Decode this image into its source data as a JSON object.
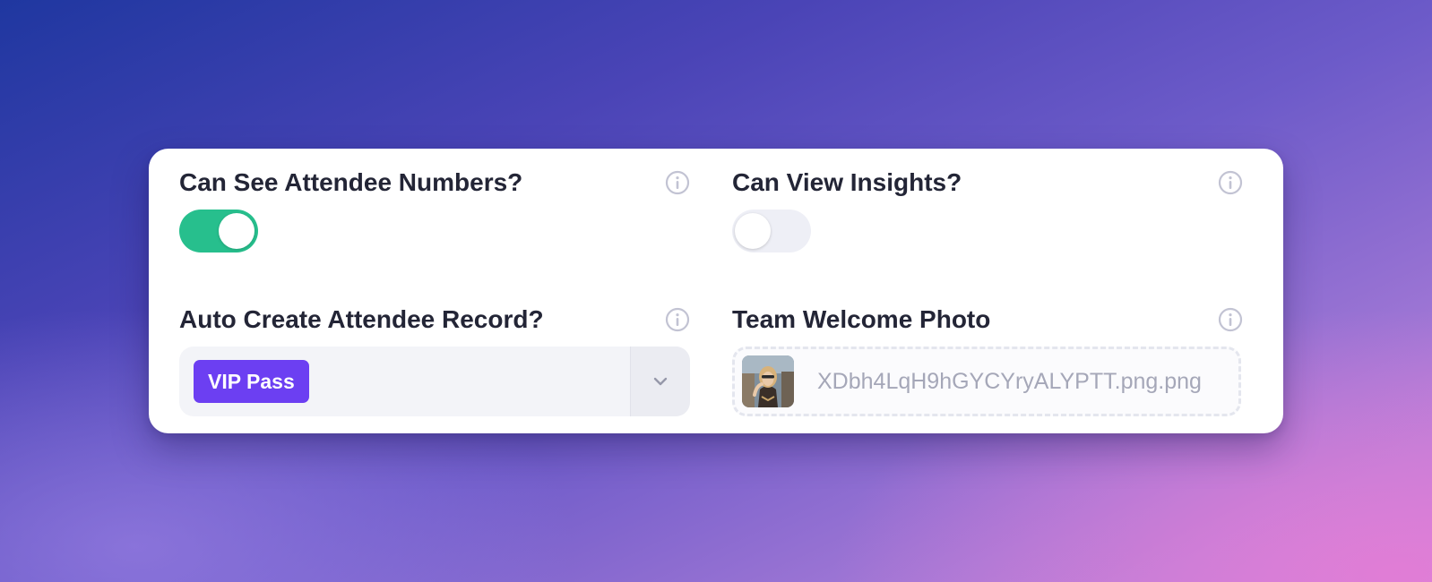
{
  "fields": {
    "attendee_numbers": {
      "label": "Can See Attendee Numbers?",
      "enabled": true,
      "info_icon": "info-circle-icon"
    },
    "view_insights": {
      "label": "Can View Insights?",
      "enabled": false,
      "info_icon": "info-circle-icon"
    },
    "auto_create_record": {
      "label": "Auto Create Attendee Record?",
      "selected_tag": "VIP Pass",
      "dropdown_icon": "chevron-down-icon",
      "info_icon": "info-circle-icon"
    },
    "team_welcome_photo": {
      "label": "Team Welcome Photo",
      "file_name": "XDbh4LqH9hGYCYryALYPTT.png.png",
      "info_icon": "info-circle-icon"
    }
  },
  "colors": {
    "toggle_on": "#27bf8d",
    "toggle_off": "#eeeff6",
    "tag": "#6c3ff2",
    "label": "#232536",
    "info_icon": "#c2c3d3",
    "file_name": "#a5a7b8"
  }
}
